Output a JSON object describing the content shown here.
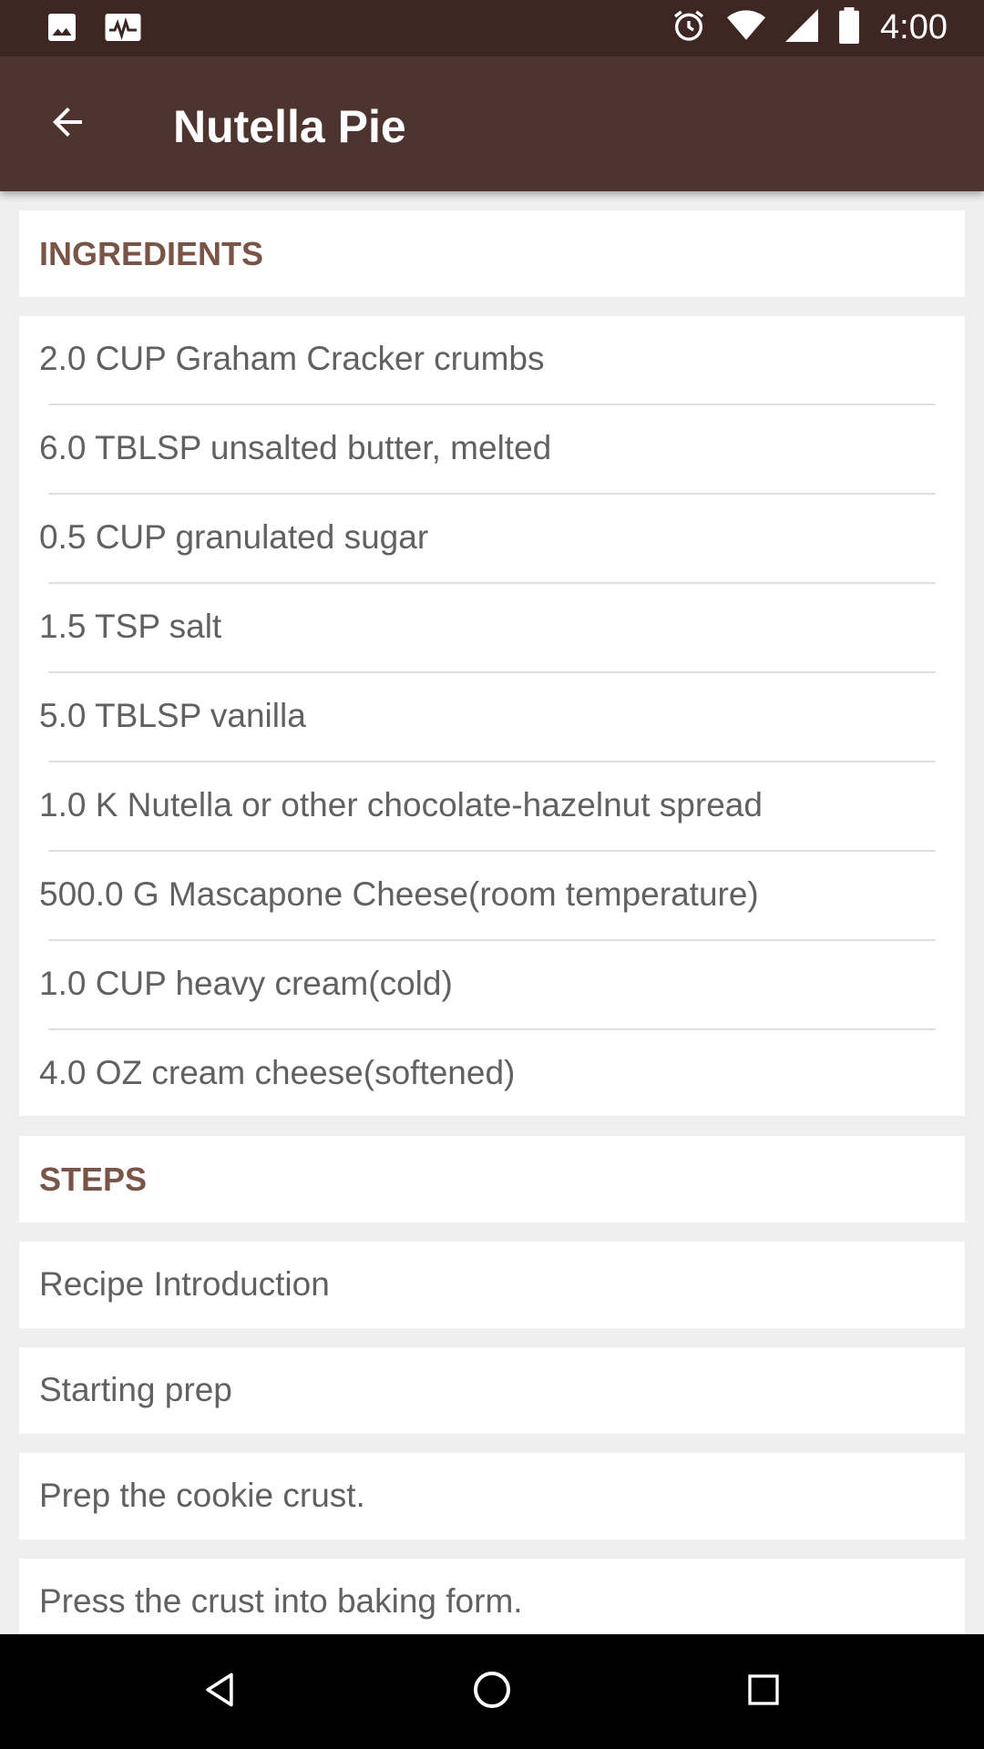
{
  "status_bar": {
    "time": "4:00",
    "icons": [
      "image-icon",
      "activity-icon",
      "alarm-icon",
      "wifi-icon",
      "signal-icon",
      "battery-icon"
    ]
  },
  "app_bar": {
    "title": "Nutella Pie",
    "back_icon": "arrow-back-icon"
  },
  "ingredients": {
    "header": "INGREDIENTS",
    "items": [
      "2.0 CUP Graham Cracker crumbs",
      "6.0 TBLSP unsalted butter, melted",
      "0.5 CUP granulated sugar",
      "1.5 TSP salt",
      "5.0 TBLSP vanilla",
      "1.0 K Nutella or other chocolate-hazelnut spread",
      "500.0 G Mascapone Cheese(room temperature)",
      "1.0 CUP heavy cream(cold)",
      "4.0 OZ cream cheese(softened)"
    ]
  },
  "steps": {
    "header": "STEPS",
    "items": [
      "Recipe Introduction",
      "Starting prep",
      "Prep the cookie crust.",
      "Press the crust into baking form."
    ]
  },
  "nav_bar": {
    "icons": [
      "nav-back-icon",
      "nav-home-icon",
      "nav-recents-icon"
    ]
  },
  "colors": {
    "status_bar": "#3e2723",
    "app_bar": "#4e342e",
    "section_header": "#795548",
    "item_text": "#616161",
    "background": "#efefef"
  }
}
